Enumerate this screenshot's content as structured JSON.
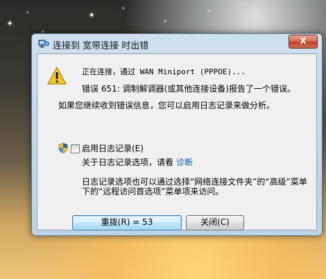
{
  "dialog": {
    "title": "连接到 宽带连接 时出错",
    "close_label": "X"
  },
  "message": {
    "status_line": "正在连接，通过 WAN Miniport (PPPOE)...",
    "error_line": "错误 651: 调制解调器(或其他连接设备)报告了一个错误。",
    "hint_line": "如果您继续收到错误信息，您可以启用日志记录来做分析。"
  },
  "logging": {
    "checkbox_label": "启用日志记录(E)",
    "checked": false,
    "about_prefix": "关于日志记录选项，请看",
    "about_link": "诊断",
    "info_line1": "日志记录选项也可以通过选择“网络连接文件夹”的“高级”菜单",
    "info_line2": "下的“远程访问首选项”菜单项来访问。"
  },
  "buttons": {
    "redial_label": "重拨(R) = 53",
    "close_label": "关闭(C)"
  },
  "icons": {
    "title": "network-connection-icon",
    "warning": "warning-icon",
    "shield": "uac-shield-icon"
  }
}
